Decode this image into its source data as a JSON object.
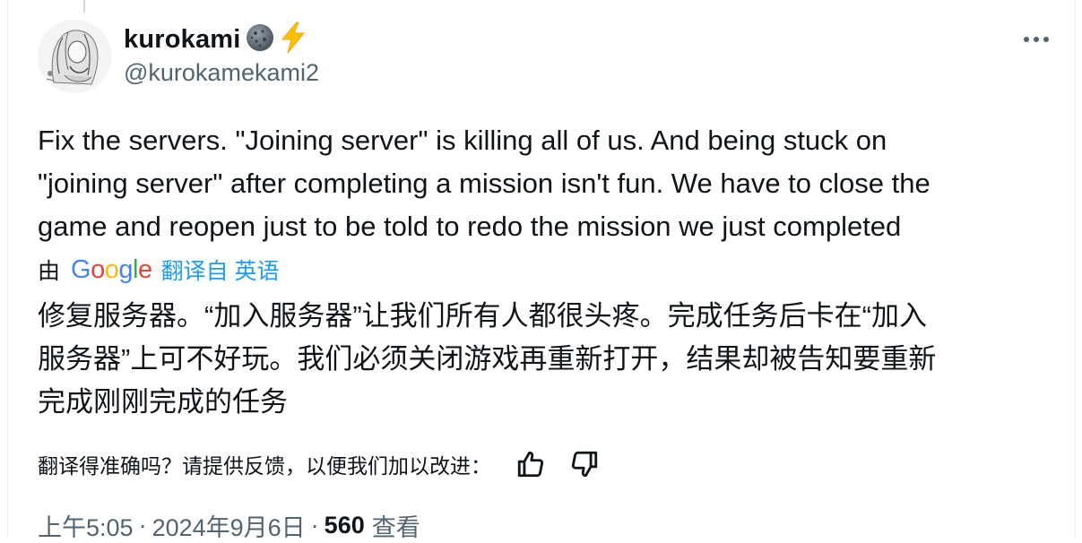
{
  "author": {
    "display_name": "kurokami",
    "handle": "@kurokamekami2",
    "badges": [
      "sphere-badge-icon",
      "lightning-emoji-icon"
    ]
  },
  "tweet": {
    "text": "Fix the servers. \"Joining server\" is killing all of us. And being stuck on\n\"joining server\" after completing a mission isn't fun. We have to close the\ngame and reopen just to be told to redo the mission we just completed"
  },
  "translation": {
    "by_label": "由",
    "provider": "Google",
    "translated_from": "翻译自 英语",
    "text": "修复服务器。“加入服务器”让我们所有人都很头疼。完成任务后卡在“加入\n服务器”上可不好玩。我们必须关闭游戏再重新打开，结果却被告知要重新\n完成刚刚完成的任务",
    "feedback_prompt": "翻译得准确吗？请提供反馈，以便我们加以改进："
  },
  "meta": {
    "time": "上午5:05",
    "date": "2024年9月6日",
    "separator": "·",
    "views_count": "560",
    "views_label": "查看"
  },
  "colors": {
    "text_primary": "#0f1419",
    "text_secondary": "#536471",
    "link_blue": "#1d9bf0",
    "google_blue": "#4285F4",
    "google_red": "#EA4335",
    "google_yellow": "#FBBC05",
    "google_green": "#34A853"
  }
}
